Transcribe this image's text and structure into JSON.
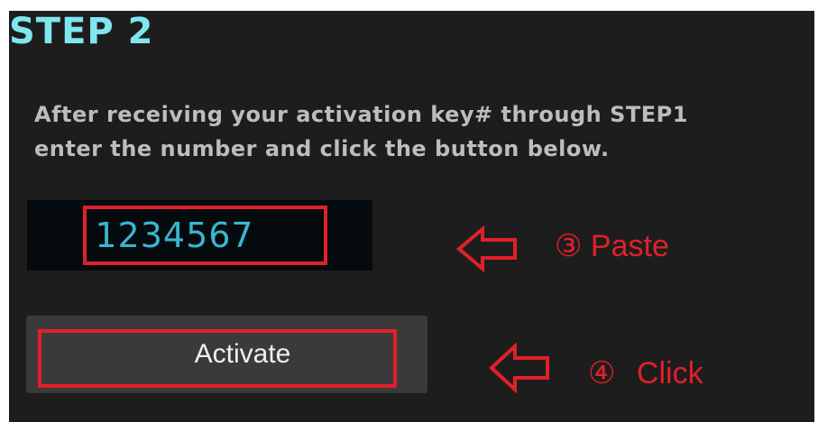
{
  "step": {
    "title": "STEP 2"
  },
  "instructions": {
    "line1": "After receiving your activation key# through STEP1",
    "line2": "enter the number and click the button below."
  },
  "activation_key": {
    "value": "1234567"
  },
  "activate_button": {
    "label": "Activate"
  },
  "annotations": {
    "paste": "③ Paste",
    "click": "④ Click"
  },
  "colors": {
    "title": "#7fe6f0",
    "highlight": "#e0202a",
    "key_text": "#37b7cc",
    "panel_bg": "#1d1d1d"
  }
}
